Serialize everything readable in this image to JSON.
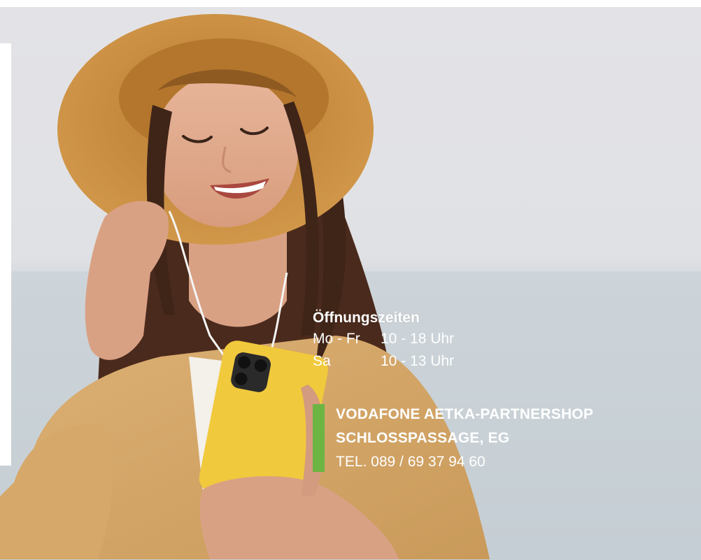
{
  "hours": {
    "title": "Öffnungszeiten",
    "rows": [
      {
        "day": "Mo - Fr",
        "time": "10 - 18 Uhr"
      },
      {
        "day": "Sa",
        "time": "10 - 13 Uhr"
      }
    ]
  },
  "shop": {
    "name": "VODAFONE AETKA-PARTNERSHOP",
    "location": "SCHLOSSPASSAGE, EG",
    "phone": "TEL. 089 / 69 37 94 60"
  },
  "colors": {
    "accent_green": "#6cb543",
    "text": "#ffffff",
    "sky": "#dedfe3",
    "sea": "#c9d2d8",
    "hat": "#c9893a",
    "shirt": "#d7a865",
    "phone": "#f2cb3f"
  }
}
